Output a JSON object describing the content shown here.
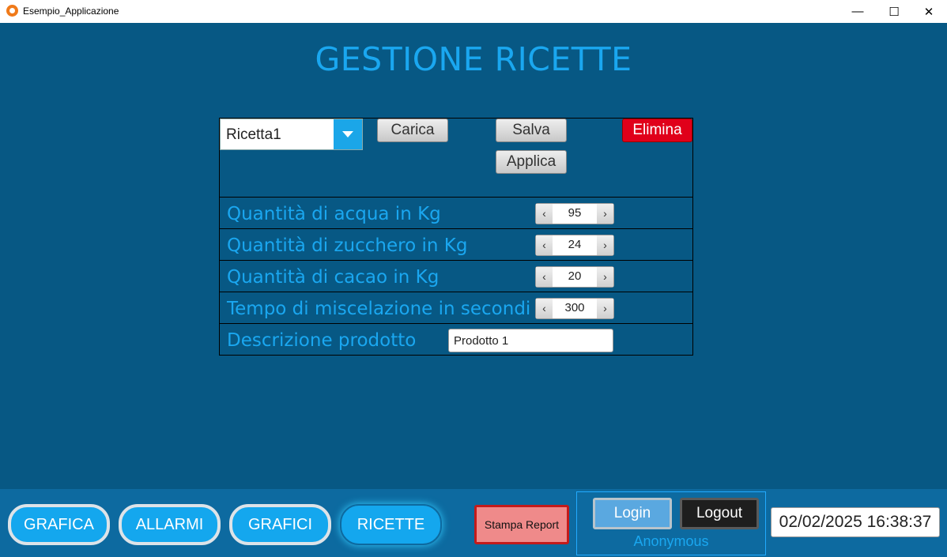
{
  "window": {
    "title": "Esempio_Applicazione",
    "minimize": "—",
    "maximize": "☐",
    "close": "✕"
  },
  "page": {
    "title": "GESTIONE RICETTE"
  },
  "recipe": {
    "selected": "Ricetta1",
    "load_label": "Carica",
    "save_label": "Salva",
    "apply_label": "Applica",
    "delete_label": "Elimina"
  },
  "params": [
    {
      "label": "Quantità di acqua in Kg",
      "value": "95"
    },
    {
      "label": "Quantità di zucchero in Kg",
      "value": "24"
    },
    {
      "label": "Quantità di cacao in Kg",
      "value": "20"
    },
    {
      "label": "Tempo di miscelazione in secondi",
      "value": "300"
    }
  ],
  "description": {
    "label": "Descrizione prodotto",
    "value": "Prodotto 1"
  },
  "stepper": {
    "dec": "‹",
    "inc": "›"
  },
  "nav": [
    {
      "label": "GRAFICA",
      "active": false
    },
    {
      "label": "ALLARMI",
      "active": false
    },
    {
      "label": "GRAFICI",
      "active": false
    },
    {
      "label": "RICETTE",
      "active": true
    }
  ],
  "report": {
    "label": "Stampa Report"
  },
  "auth": {
    "login_label": "Login",
    "logout_label": "Logout",
    "user": "Anonymous"
  },
  "datetime": "02/02/2025 16:38:37",
  "colors": {
    "background": "#075884",
    "accent": "#1aa7f0",
    "delete": "#e0001a"
  }
}
